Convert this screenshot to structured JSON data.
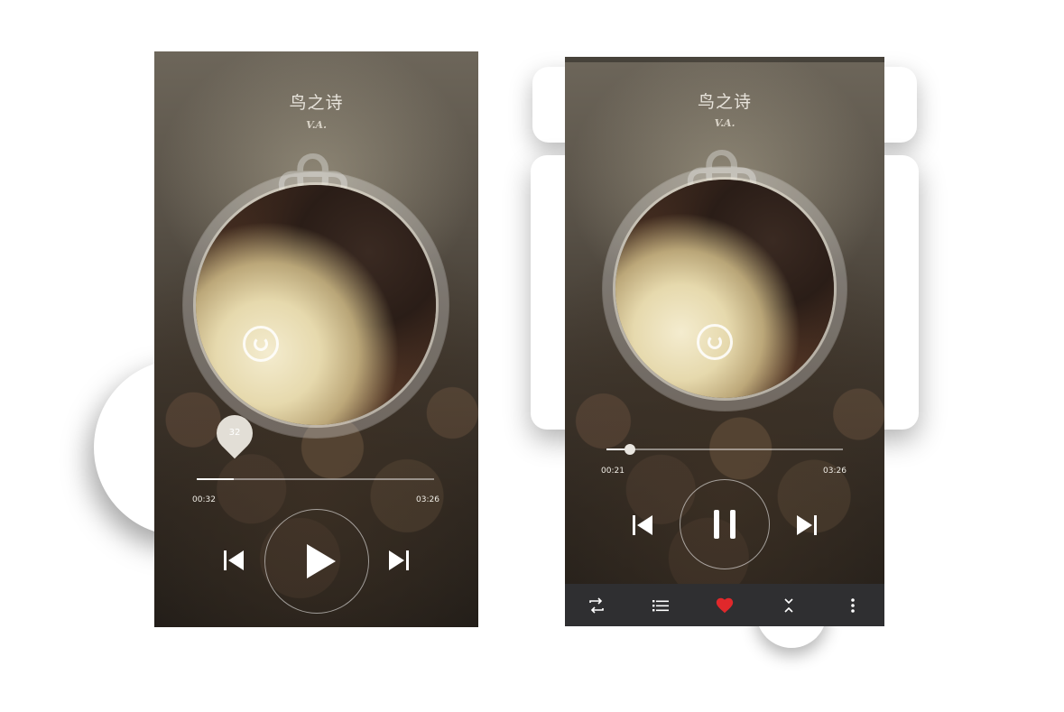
{
  "left_player": {
    "title": "鸟之诗",
    "artist": "V.A.",
    "elapsed": "00:32",
    "duration": "03:26",
    "progress": 0.155,
    "volume_bubble": "32",
    "state": "paused"
  },
  "right_player": {
    "title": "鸟之诗",
    "artist": "V.A.",
    "elapsed": "00:21",
    "duration": "03:26",
    "progress": 0.1,
    "state": "playing",
    "bottom_bar": {
      "icons": [
        "repeat-icon",
        "playlist-icon",
        "heart-icon",
        "collapse-icon",
        "more-icon"
      ],
      "favorite_color": "#e0282b"
    }
  },
  "colors": {
    "accent_heart": "#e0282b",
    "bar_bg": "#2f2f31"
  }
}
